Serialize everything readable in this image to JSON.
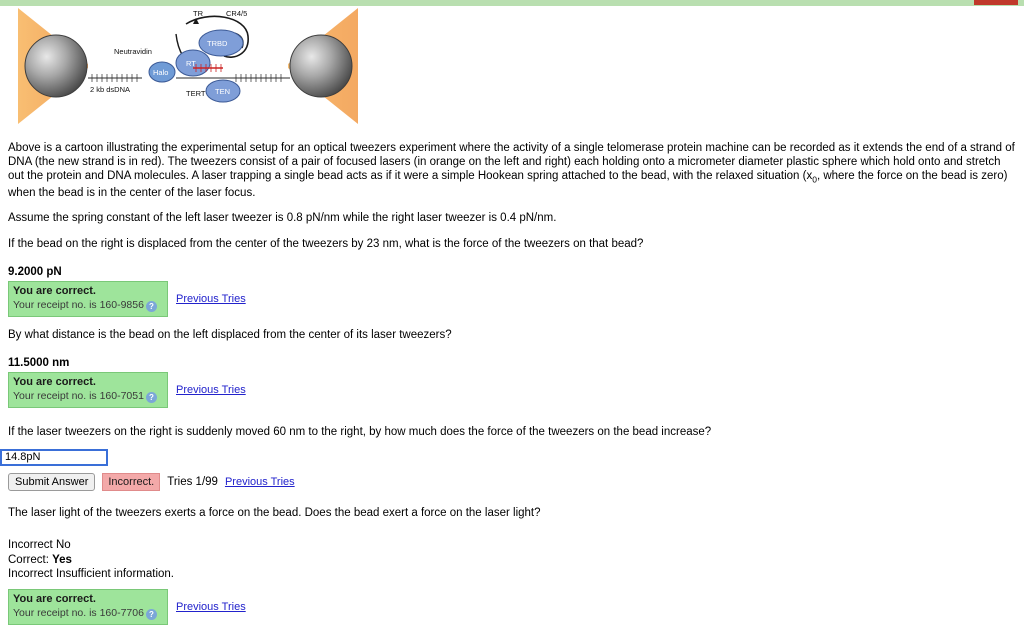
{
  "figure": {
    "labels": {
      "neutravidin": "Neutravidin",
      "dsdna": "2 kb dsDNA",
      "halo": "Halo",
      "rt": "RT",
      "trbd": "TRBD",
      "ten": "TEN",
      "tert": "TERT",
      "tr": "TR",
      "cr45": "CR4/5"
    },
    "colors": {
      "laser": "#F5A84B",
      "bead": "#8c8c8c",
      "protein": "#6f90d0",
      "rna": "#cc2222"
    }
  },
  "intro": {
    "text": "Above is a cartoon illustrating the experimental setup for an optical tweezers experiment where the activity of a single telomerase protein machine can be recorded as it extends the end of a strand of DNA (the new strand is in red). The tweezers consist of a pair of focused lasers (in orange on the left and right) each holding onto a micrometer diameter plastic sphere which hold onto and stretch out the protein and DNA molecules. A laser trapping a single bead acts as if it were a simple Hookean spring attached to the bead, with the relaxed situation (x",
    "subscript": "0",
    "text_after": ", where the force on the bead is zero) when the bead is in the center of the laser focus."
  },
  "assumption": "Assume the spring constant of the left laser tweezer is 0.8 pN/nm while the right laser tweezer is 0.4 pN/nm.",
  "questions": [
    {
      "prompt": "If the bead on the right is displaced from the center of the tweezers by 23 nm, what is the force of the tweezers on that bead?",
      "answer": "9.2000 pN",
      "status_title": "You are correct.",
      "receipt": "Your receipt no. is 160-9856",
      "previous_tries": "Previous Tries"
    },
    {
      "prompt": "By what distance is the bead on the left displaced from the center of its laser tweezers?",
      "answer": "11.5000 nm",
      "status_title": "You are correct.",
      "receipt": "Your receipt no. is 160-7051",
      "previous_tries": "Previous Tries"
    }
  ],
  "open_question": {
    "prompt": "If the laser tweezers on the right is suddenly moved 60 nm to the right, by how much does the force of the tweezers on the bead increase?",
    "input_value": "14.8pN",
    "submit_label": "Submit Answer",
    "incorrect_label": "Incorrect.",
    "tries": "Tries 1/99",
    "previous_tries": "Previous Tries"
  },
  "final_question": {
    "prompt": "The laser light of the tweezers exerts a force on the bead. Does the bead exert a force on the laser light?",
    "feedback_lines": [
      {
        "prefix": "Incorrect ",
        "value": "No",
        "bold": false
      },
      {
        "prefix": "Correct: ",
        "value": "Yes",
        "bold": true
      },
      {
        "prefix": "Incorrect ",
        "value": "Insufficient information.",
        "bold": false
      }
    ],
    "status_title": "You are correct.",
    "receipt": "Your receipt no. is 160-7706",
    "previous_tries": "Previous Tries"
  }
}
